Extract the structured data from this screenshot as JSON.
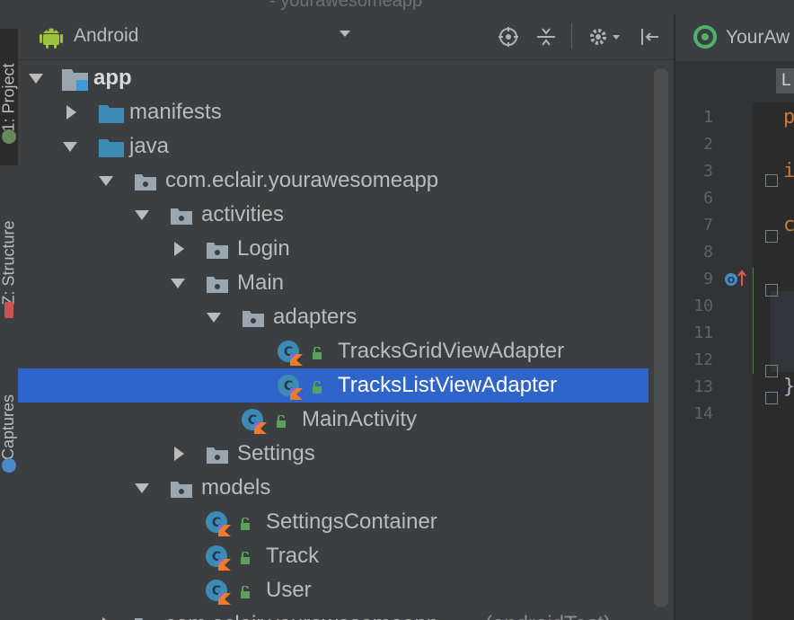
{
  "window": {
    "title_fragment": "- yourawesomeapp"
  },
  "left_toolbar": {
    "tabs": [
      {
        "label": "1: Project"
      },
      {
        "label": "Z: Structure"
      },
      {
        "label": "Captures"
      }
    ]
  },
  "project_panel": {
    "view_selector": {
      "value": "Android",
      "icon": "android-icon"
    },
    "header_icons": [
      "locate-icon",
      "collapse-all-icon",
      "settings-gear-icon",
      "hide-panel-icon"
    ],
    "tree": [
      {
        "label": "app",
        "bold": true,
        "expanded": true,
        "icon": "module-icon"
      },
      {
        "label": "manifests",
        "expanded": false,
        "icon": "folder-icon"
      },
      {
        "label": "java",
        "expanded": true,
        "icon": "folder-icon"
      },
      {
        "label": "com.eclair.yourawesomeapp",
        "expanded": true,
        "icon": "package-icon"
      },
      {
        "label": "activities",
        "expanded": true,
        "icon": "package-icon"
      },
      {
        "label": "Login",
        "expanded": false,
        "icon": "package-icon"
      },
      {
        "label": "Main",
        "expanded": true,
        "icon": "package-icon"
      },
      {
        "label": "adapters",
        "expanded": true,
        "icon": "package-icon"
      },
      {
        "label": "TracksGridViewAdapter",
        "icon": "kotlin-class-icon"
      },
      {
        "label": "TracksListViewAdapter",
        "icon": "kotlin-class-icon",
        "selected": true
      },
      {
        "label": "MainActivity",
        "icon": "kotlin-class-icon"
      },
      {
        "label": "Settings",
        "expanded": false,
        "icon": "package-icon"
      },
      {
        "label": "models",
        "expanded": true,
        "icon": "package-icon"
      },
      {
        "label": "SettingsContainer",
        "icon": "kotlin-class-icon"
      },
      {
        "label": "Track",
        "icon": "kotlin-class-icon"
      },
      {
        "label": "User",
        "icon": "kotlin-class-icon"
      },
      {
        "label": "com.eclair.yourawesomeapp",
        "suffix": "(androidTest)",
        "expanded": false,
        "icon": "package-icon"
      }
    ]
  },
  "editor": {
    "tab_label": "YourAw",
    "breadcrumb_chip": "L",
    "line_numbers": [
      "1",
      "2",
      "3",
      "6",
      "7",
      "8",
      "9",
      "10",
      "11",
      "12",
      "13",
      "14"
    ],
    "code_fragments": [
      "p",
      "i",
      "c",
      "}"
    ]
  },
  "colors": {
    "panel_bg": "#3c3f41",
    "selection": "#2f65ca",
    "folder_blue": "#3d8bb5",
    "editor_bg": "#2b2b2b",
    "keyword": "#cc7832"
  }
}
